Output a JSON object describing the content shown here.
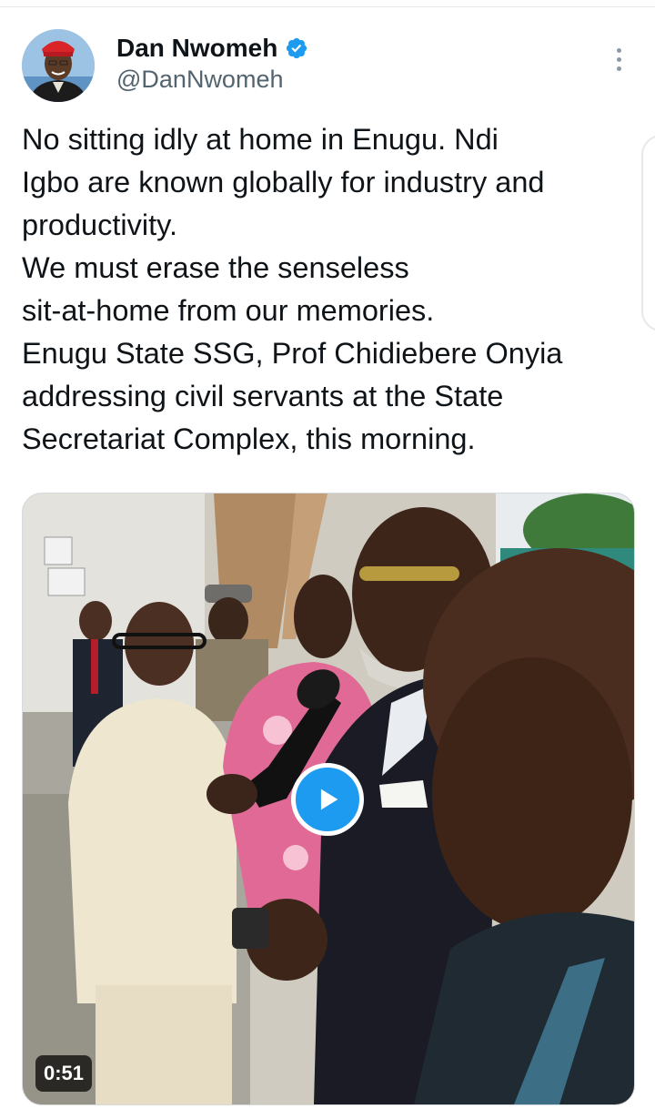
{
  "author": {
    "display_name": "Dan Nwomeh",
    "handle": "@DanNwomeh",
    "verified": true
  },
  "tweet": {
    "lines": [
      "No sitting idly at home in Enugu. Ndi",
      "Igbo are known globally for industry and",
      "productivity.",
      "We must erase the senseless",
      "sit-at-home from our memories.",
      "Enugu State SSG, Prof Chidiebere Onyia",
      "addressing civil servants at the State",
      "Secretariat Complex, this morning."
    ]
  },
  "video": {
    "duration": "0:51"
  },
  "icons": {
    "verified": "verified-badge-icon",
    "more": "more-vertical-icon",
    "play": "play-icon"
  },
  "colors": {
    "accent": "#1d9bf0",
    "text": "#0f1419",
    "secondary": "#536471"
  }
}
